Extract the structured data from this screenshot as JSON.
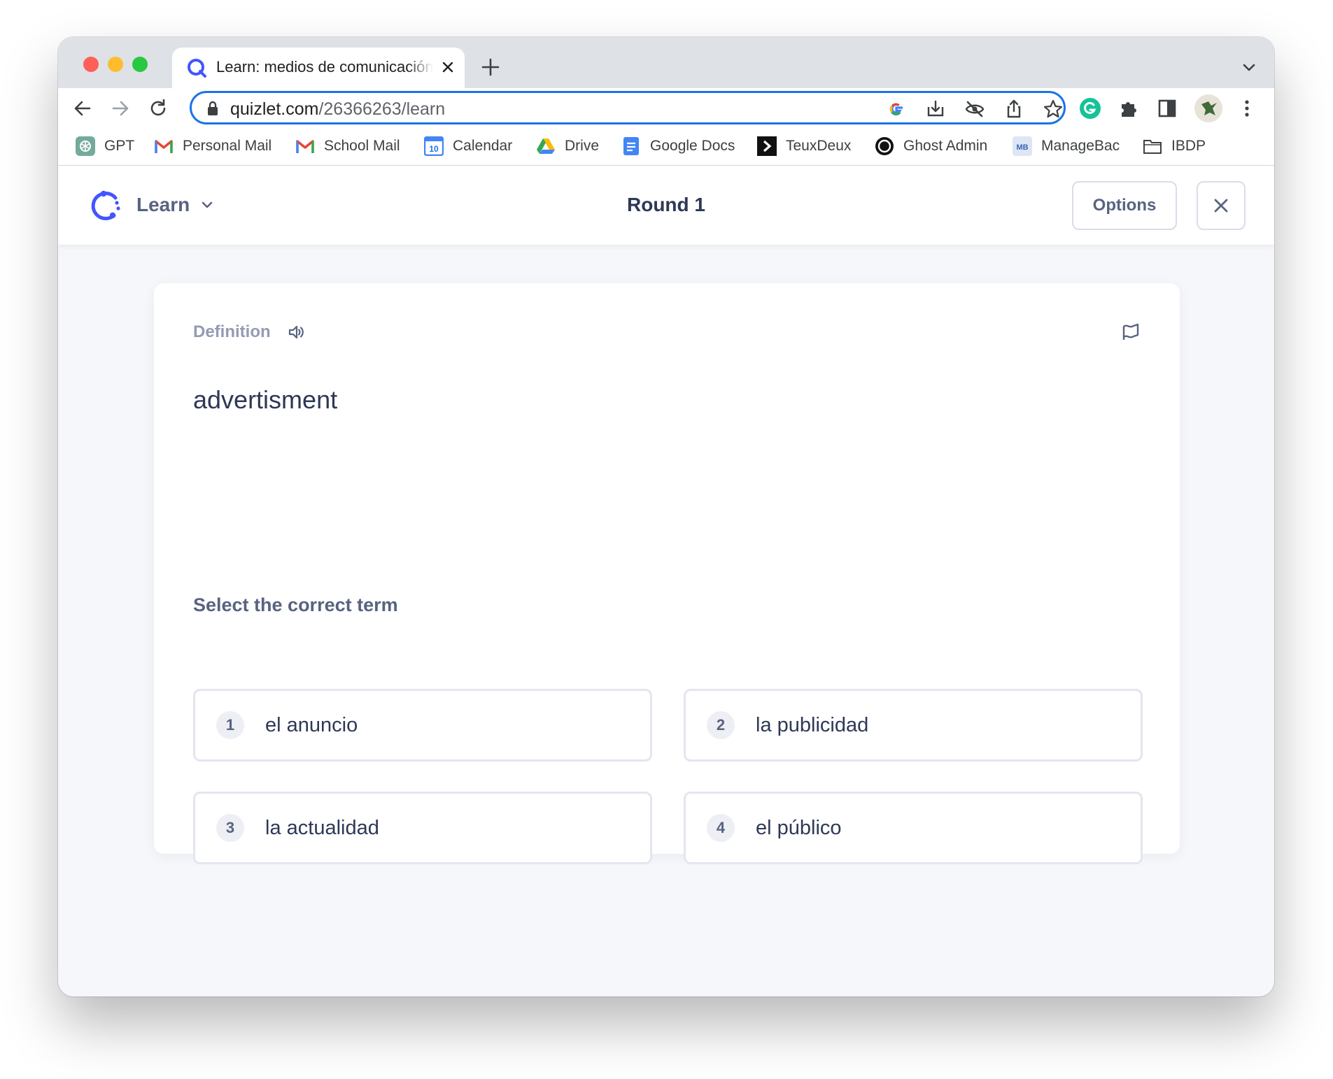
{
  "browser": {
    "tab": {
      "title": "Learn: medios de comunicación"
    },
    "address": {
      "domain": "quizlet.com",
      "path": "/26366263/learn"
    },
    "bookmarks": [
      {
        "label": "GPT",
        "icon": "openai-icon"
      },
      {
        "label": "Personal Mail",
        "icon": "gmail-icon"
      },
      {
        "label": "School Mail",
        "icon": "gmail-icon"
      },
      {
        "label": "Calendar",
        "icon": "calendar-icon",
        "icon_text": "10"
      },
      {
        "label": "Drive",
        "icon": "drive-icon"
      },
      {
        "label": "Google Docs",
        "icon": "docs-icon"
      },
      {
        "label": "TeuxDeux",
        "icon": "teuxdeux-icon"
      },
      {
        "label": "Ghost Admin",
        "icon": "ghost-icon"
      },
      {
        "label": "ManageBac",
        "icon": "managebac-icon",
        "icon_text": "MB"
      },
      {
        "label": "IBDP",
        "icon": "folder-icon"
      }
    ]
  },
  "app": {
    "mode_label": "Learn",
    "round_label": "Round 1",
    "options_label": "Options",
    "accent": "#4255ff"
  },
  "question": {
    "side_label": "Definition",
    "prompt": "advertisment",
    "instruction": "Select the correct term",
    "choices": [
      {
        "number": "1",
        "text": "el anuncio"
      },
      {
        "number": "2",
        "text": "la publicidad"
      },
      {
        "number": "3",
        "text": "la actualidad"
      },
      {
        "number": "4",
        "text": "el público"
      }
    ]
  }
}
